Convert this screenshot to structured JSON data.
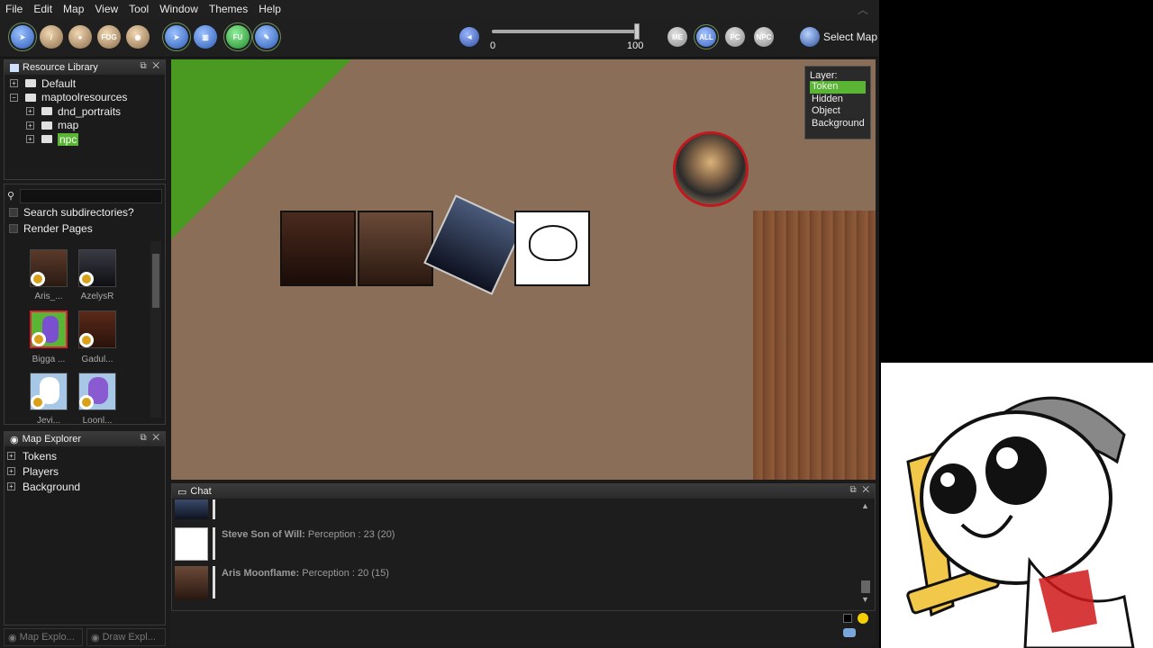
{
  "menu": [
    "File",
    "Edit",
    "Map",
    "View",
    "Tool",
    "Window",
    "Themes",
    "Help"
  ],
  "toolbar": {
    "tools": [
      "pointer",
      "draw",
      "shape",
      "FOG",
      "eye"
    ],
    "views": [
      "select",
      "grid",
      "FU",
      "paint"
    ],
    "volume": {
      "min": "0",
      "max": "100",
      "value": 1.0
    },
    "visibility": [
      "ME",
      "ALL",
      "PC",
      "NPC"
    ],
    "select_map_label": "Select Map"
  },
  "resource_library": {
    "title": "Resource Library",
    "tree": [
      {
        "label": "Default",
        "level": 0
      },
      {
        "label": "maptoolresources",
        "level": 0
      },
      {
        "label": "dnd_portraits",
        "level": 1
      },
      {
        "label": "map",
        "level": 1
      },
      {
        "label": "npc",
        "level": 1,
        "selected": true
      }
    ],
    "search_subdirectories": "Search subdirectories?",
    "render_pages": "Render Pages",
    "thumbnails": [
      "Aris_...",
      "AzelysR",
      "Bigga ...",
      "Gadul...",
      "Jevi...",
      "Loonl..."
    ]
  },
  "map_explorer": {
    "title": "Map Explorer",
    "items": [
      "Tokens",
      "Players",
      "Background"
    ]
  },
  "layers": {
    "title": "Layer:",
    "items": [
      "Token",
      "Hidden",
      "Object",
      "Background"
    ],
    "active": "Token"
  },
  "chat": {
    "title": "Chat",
    "messages": [
      {
        "speaker": "Steve Son of Will:",
        "text": "Perception : 23 (20)"
      },
      {
        "speaker": "Aris Moonflame:",
        "text": "Perception : 20 (15)"
      }
    ]
  },
  "bottom_tabs": [
    "Map Explo...",
    "Draw Expl..."
  ]
}
